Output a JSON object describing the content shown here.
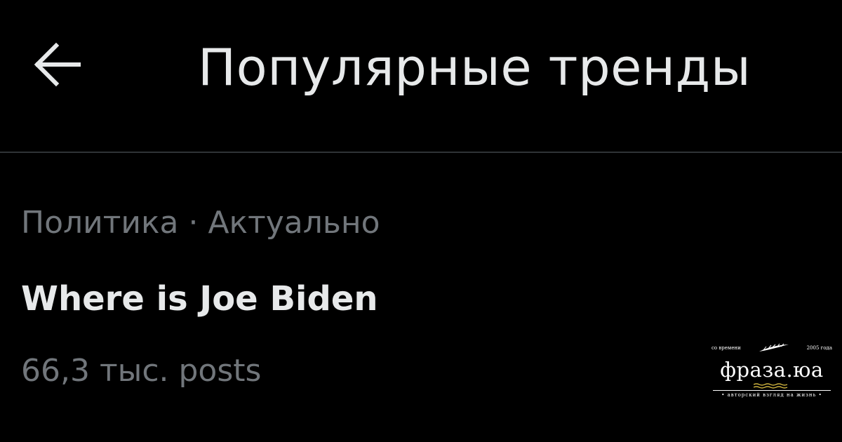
{
  "header": {
    "back_icon": "arrow-left-icon",
    "title": "Популярные тренды"
  },
  "trend": {
    "context": "Политика · Актуально",
    "name": "Where is Joe Biden",
    "count": "66,3 тыс. posts"
  },
  "watermark": {
    "top_left": "со времени",
    "top_right": "2005 года",
    "brand": "фраза.юа",
    "tagline": "• авторский взгляд на жизнь •",
    "emblem_icon": "feather-icon"
  },
  "colors": {
    "background": "#000000",
    "primary_text": "#e7e9ea",
    "secondary_text": "#71767b",
    "divider": "#2f3336"
  }
}
